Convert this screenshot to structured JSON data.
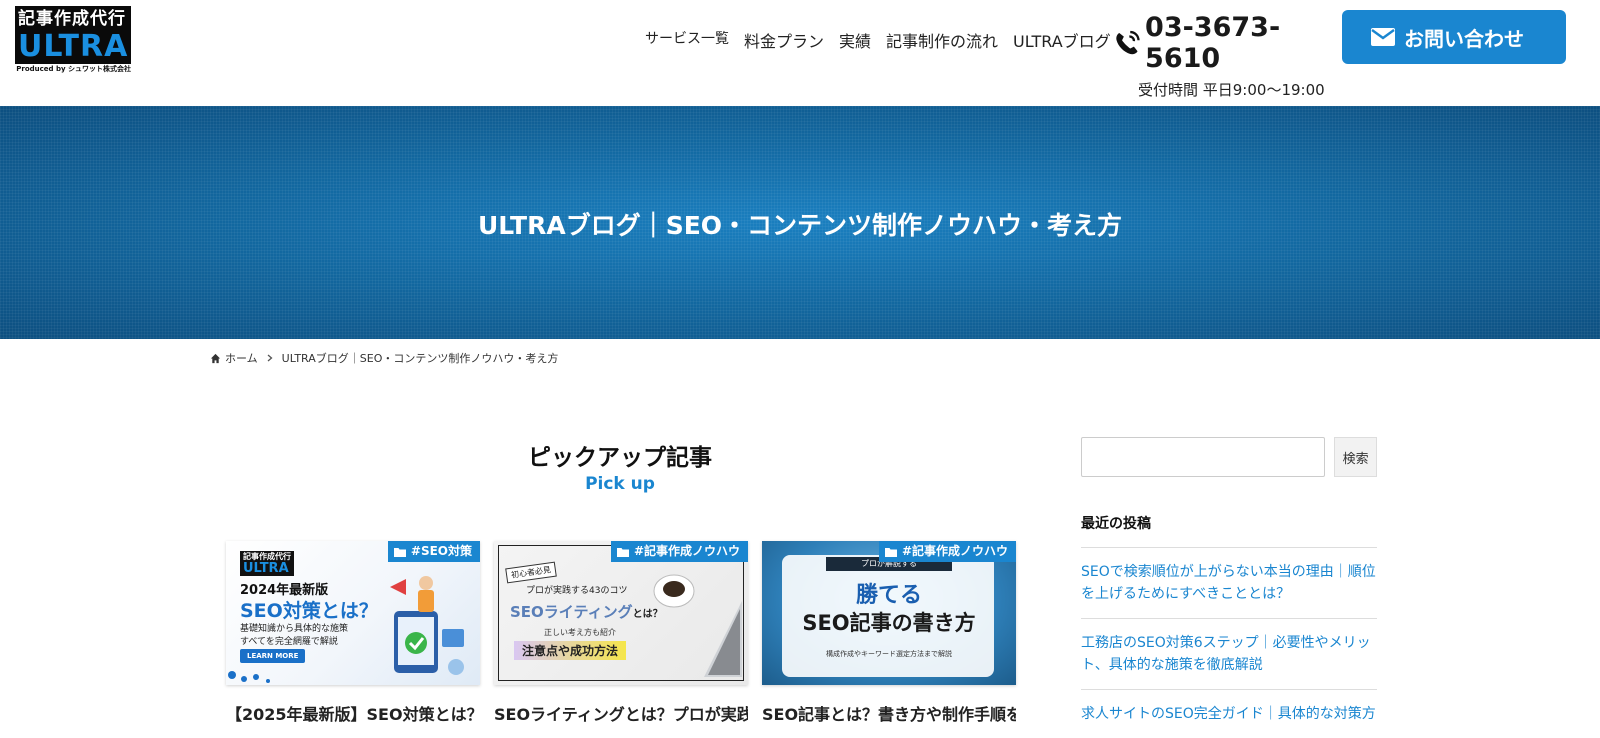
{
  "header": {
    "logo": {
      "top": "記事作成代行",
      "main": "ULTRA",
      "sub": "Produced by シュワット株式会社"
    },
    "nav": [
      "サービス一覧",
      "料金プラン",
      "実績",
      "記事制作の流れ",
      "ULTRAブログ"
    ],
    "phone": {
      "number": "03-3673-5610",
      "hours": "受付時間 平日9:00〜19:00"
    },
    "contact_label": "お問い合わせ"
  },
  "hero": {
    "title": "ULTRAブログ｜SEO・コンテンツ制作ノウハウ・考え方"
  },
  "breadcrumb": {
    "home": "ホーム",
    "current": "ULTRAブログ｜SEO・コンテンツ制作ノウハウ・考え方"
  },
  "pickup": {
    "title": "ピックアップ記事",
    "subtitle": "Pick up",
    "cards": [
      {
        "tag": "#SEO対策",
        "title": "【2025年最新版】SEO対策とは？",
        "thumb": {
          "logo_top": "記事作成代行",
          "logo_main": "ULTRA",
          "line1": "2024年最新版",
          "line2": "SEO対策とは？",
          "line3": "基礎知識から具体的な施策",
          "line4": "すべてを完全網羅で解説",
          "cta": "LEARN MORE"
        }
      },
      {
        "tag": "#記事作成ノウハウ",
        "title": "SEOライティングとは？プロが実践",
        "thumb": {
          "badge": "初心者必見",
          "line1": "プロが実践する43のコツ",
          "line2": "SEOライティング",
          "line2b": "とは？",
          "line3": "正しい考え方も紹介",
          "line4": "注意点や成功方法"
        }
      },
      {
        "tag": "#記事作成ノウハウ",
        "title": "SEO記事とは？書き方や制作手順を",
        "thumb": {
          "top": "プロが解説する",
          "line1": "勝てる",
          "line2": "SEO記事の書き方",
          "line3": "構成作成やキーワード選定方法まで解説"
        }
      }
    ]
  },
  "sidebar": {
    "search_button": "検索",
    "search_placeholder": "",
    "recent_heading": "最近の投稿",
    "recent_posts": [
      "SEOで検索順位が上がらない本当の理由｜順位を上げるためにすべきこととは？",
      "工務店のSEO対策6ステップ｜必要性やメリット、具体的な施策を徹底解説",
      "求人サイトのSEO完全ガイド｜具体的な対策方"
    ]
  },
  "colors": {
    "accent": "#1a86d0",
    "hero": "#136aa3"
  }
}
